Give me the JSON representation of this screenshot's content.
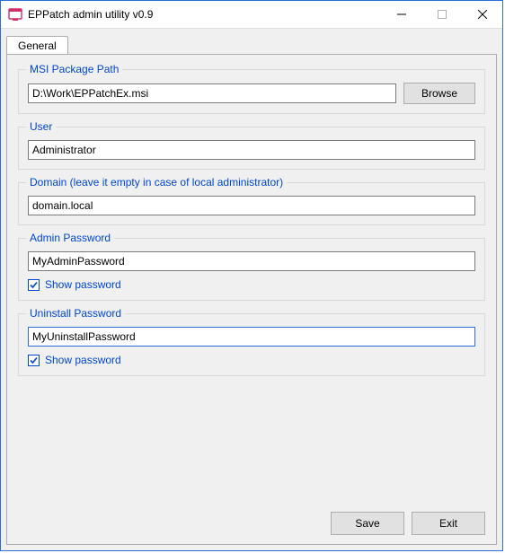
{
  "window": {
    "title": "EPPatch admin utility v0.9"
  },
  "tabs": {
    "general": "General"
  },
  "groups": {
    "msi": {
      "legend": "MSI Package Path",
      "path_value": "D:\\Work\\EPPatchEx.msi",
      "browse_label": "Browse"
    },
    "user": {
      "legend": "User",
      "value": "Administrator"
    },
    "domain": {
      "legend": "Domain (leave it empty in case of local administrator)",
      "value": "domain.local"
    },
    "admin_pw": {
      "legend": "Admin Password",
      "value": "MyAdminPassword",
      "show_label": "Show password"
    },
    "uninstall_pw": {
      "legend": "Uninstall Password",
      "value": "MyUninstallPassword",
      "show_label": "Show password"
    }
  },
  "footer": {
    "save": "Save",
    "exit": "Exit"
  }
}
